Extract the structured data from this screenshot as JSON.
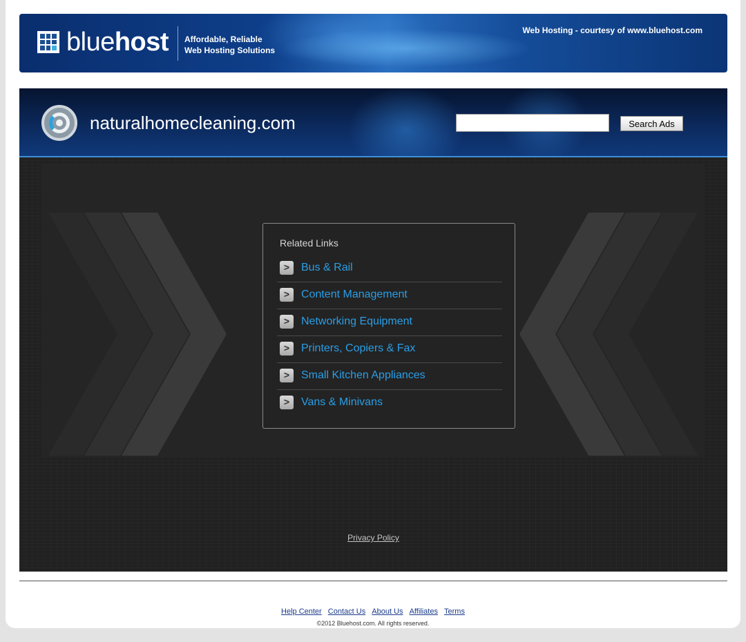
{
  "banner": {
    "logo_text_light": "blue",
    "logo_text_bold": "host",
    "tagline_line1": "Affordable, Reliable",
    "tagline_line2": "Web Hosting Solutions",
    "courtesy": "Web Hosting - courtesy of www.bluehost.com"
  },
  "header": {
    "domain": "naturalhomecleaning.com",
    "search_value": "",
    "search_button": "Search Ads"
  },
  "related": {
    "title": "Related Links",
    "links": [
      {
        "label": "Bus & Rail",
        "icon": ">"
      },
      {
        "label": "Content Management",
        "icon": ">"
      },
      {
        "label": "Networking Equipment",
        "icon": ">"
      },
      {
        "label": "Printers, Copiers & Fax",
        "icon": ">"
      },
      {
        "label": "Small Kitchen Appliances",
        "icon": ">"
      },
      {
        "label": "Vans & Minivans",
        "icon": ">"
      }
    ]
  },
  "privacy": "Privacy Policy",
  "footer": {
    "links": [
      "Help Center",
      "Contact Us",
      "About Us",
      "Affiliates",
      "Terms"
    ],
    "copyright": "©2012 Bluehost.com. All rights reserved."
  },
  "colors": {
    "link_blue": "#2a9ee6",
    "banner_blue": "#0e3f8a",
    "content_bg": "#212121"
  }
}
